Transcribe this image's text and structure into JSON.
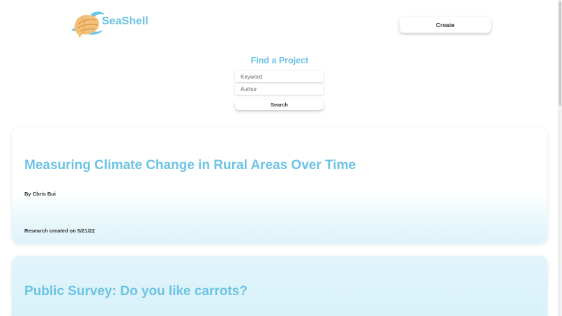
{
  "brand": {
    "name": "SeaShell",
    "accent_color": "#6dc3e3",
    "logo_icon": "seashell-wave-icon"
  },
  "header": {
    "create_label": "Create"
  },
  "search": {
    "title": "Find a Project",
    "keyword_placeholder": "Keyword",
    "author_placeholder": "Author",
    "button_label": "Search"
  },
  "projects": [
    {
      "title": "Measuring Climate Change in Rural Areas Over Time",
      "author": "By Chris Bui",
      "created": "Research created on 5/21/22"
    },
    {
      "title": "Public Survey: Do you like carrots?"
    }
  ]
}
